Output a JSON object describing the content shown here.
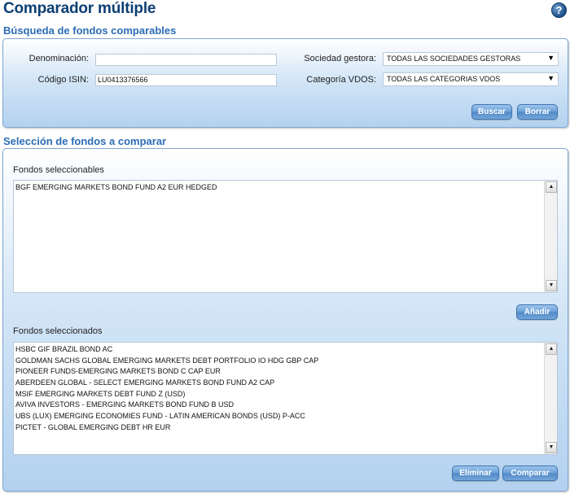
{
  "header": {
    "title": "Comparador múltiple",
    "help_icon": "?"
  },
  "search": {
    "title": "Búsqueda de fondos comparables",
    "denominacion_label": "Denominación:",
    "denominacion_value": "",
    "isin_label": "Código ISIN:",
    "isin_value": "LU0413376566",
    "gestora_label": "Sociedad gestora:",
    "gestora_selected": "TODAS LAS SOCIEDADES GESTORAS",
    "categoria_label": "Categoría VDOS:",
    "categoria_selected": "TODAS LAS CATEGORIAS VDOS",
    "dropdown_arrow": "▼",
    "buscar_label": "Buscar",
    "borrar_label": "Borrar"
  },
  "selection": {
    "title": "Selección de fondos a comparar",
    "selectable_label": "Fondos seleccionables",
    "selectable_items": [
      "BGF EMERGING MARKETS BOND FUND A2 EUR HEDGED"
    ],
    "add_label": "Añadir",
    "selected_label": "Fondos seleccionados",
    "selected_items": [
      "HSBC GIF BRAZIL BOND AC",
      "GOLDMAN SACHS GLOBAL EMERGING MARKETS DEBT PORTFOLIO IO HDG GBP CAP",
      "PIONEER FUNDS-EMERGING MARKETS BOND C CAP EUR",
      "ABERDEEN GLOBAL - SELECT EMERGING MARKETS BOND FUND A2 CAP",
      "MSIF EMERGING MARKETS DEBT FUND Z (USD)",
      "AVIVA INVESTORS - EMERGING MARKETS BOND FUND B USD",
      "UBS (LUX) EMERGING ECONOMIES FUND - LATIN AMERICAN BONDS (USD) P-ACC",
      "PICTET - GLOBAL EMERGING DEBT HR EUR"
    ],
    "remove_label": "Eliminar",
    "compare_label": "Comparar",
    "scroll_up": "▲",
    "scroll_down": "▼"
  }
}
